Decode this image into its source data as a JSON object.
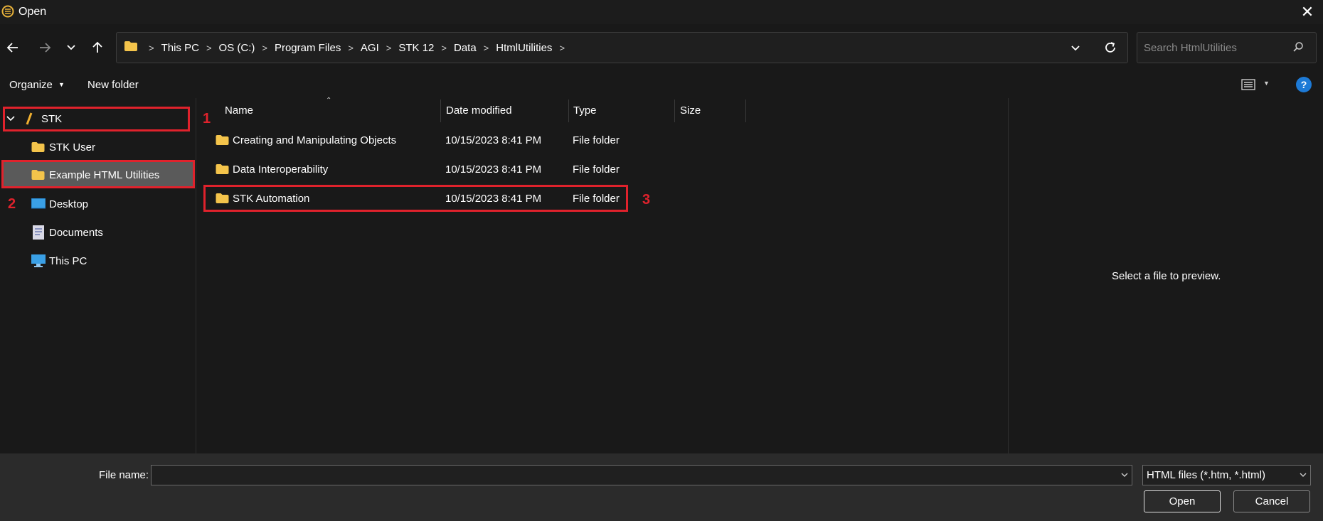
{
  "window": {
    "title": "Open",
    "close_glyph": "✕"
  },
  "nav": {
    "back_icon": "arrow-left-icon",
    "forward_icon": "arrow-right-icon",
    "recent_icon": "chevron-down-icon",
    "up_icon": "arrow-up-icon"
  },
  "address": {
    "crumbs": [
      "This PC",
      "OS (C:)",
      "Program Files",
      "AGI",
      "STK 12",
      "Data",
      "HtmlUtilities"
    ]
  },
  "search": {
    "placeholder": "Search HtmlUtilities"
  },
  "toolbar": {
    "organize_label": "Organize",
    "new_folder_label": "New folder",
    "help_label": "?"
  },
  "sidebar": {
    "items": [
      {
        "label": "STK",
        "icon": "stk-icon"
      },
      {
        "label": "STK User",
        "icon": "folder-icon"
      },
      {
        "label": "Example HTML Utilities",
        "icon": "folder-icon",
        "selected": true
      },
      {
        "label": "Desktop",
        "icon": "desktop-icon"
      },
      {
        "label": "Documents",
        "icon": "documents-icon"
      },
      {
        "label": "This PC",
        "icon": "computer-icon"
      }
    ]
  },
  "columns": {
    "name": "Name",
    "date": "Date modified",
    "type": "Type",
    "size": "Size"
  },
  "files": [
    {
      "name": "Creating and Manipulating Objects",
      "date": "10/15/2023 8:41 PM",
      "type": "File folder"
    },
    {
      "name": "Data Interoperability",
      "date": "10/15/2023 8:41 PM",
      "type": "File folder"
    },
    {
      "name": "STK Automation",
      "date": "10/15/2023 8:41 PM",
      "type": "File folder"
    }
  ],
  "preview": {
    "text": "Select a file to preview."
  },
  "bottom": {
    "file_name_label": "File name:",
    "file_name_value": "",
    "file_type": "HTML files (*.htm, *.html)",
    "open_label": "Open",
    "cancel_label": "Cancel"
  },
  "annotations": {
    "one": "1",
    "two": "2",
    "three": "3"
  },
  "colors": {
    "accent": "#1d7ad6",
    "annotation_red": "#e0222c",
    "folder_yellow": "#f4c44b",
    "selected_bg": "#5a5a5a"
  }
}
